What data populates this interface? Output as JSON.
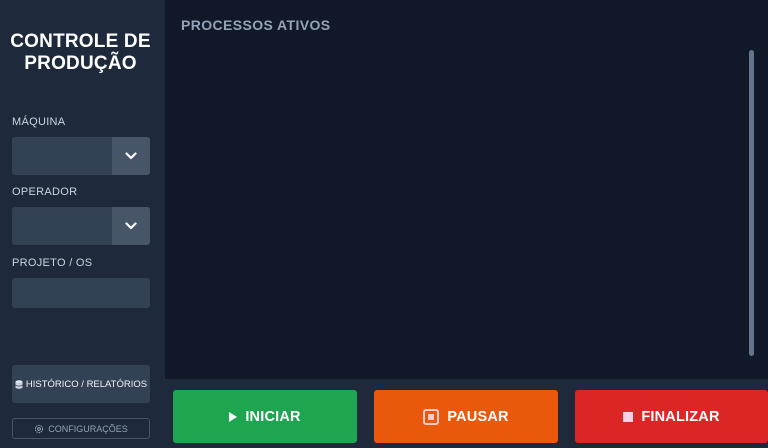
{
  "sidebar": {
    "title_line1": "CONTROLE DE",
    "title_line2": "PRODUÇÃO",
    "machine_label": "MÁQUINA",
    "machine_value": "",
    "operator_label": "OPERADOR",
    "operator_value": "",
    "project_label": "PROJETO / OS",
    "project_value": "",
    "history_button": "HISTÓRICO / RELATÓRIOS",
    "config_button": "CONFIGURAÇÕES"
  },
  "main": {
    "title": "PROCESSOS ATIVOS"
  },
  "actions": {
    "start": "INICIAR",
    "pause": "PAUSAR",
    "end": "FINALIZAR"
  },
  "icons": {
    "dropdown": "chevron-down-icon",
    "history": "database-icon",
    "config": "gear-icon",
    "start": "play-icon",
    "pause": "pause-icon",
    "end": "stop-icon"
  },
  "colors": {
    "sidebar_bg": "#1e293b",
    "main_bg": "#111827",
    "start": "#1ea550",
    "pause": "#ea580c",
    "end": "#dc2626"
  }
}
